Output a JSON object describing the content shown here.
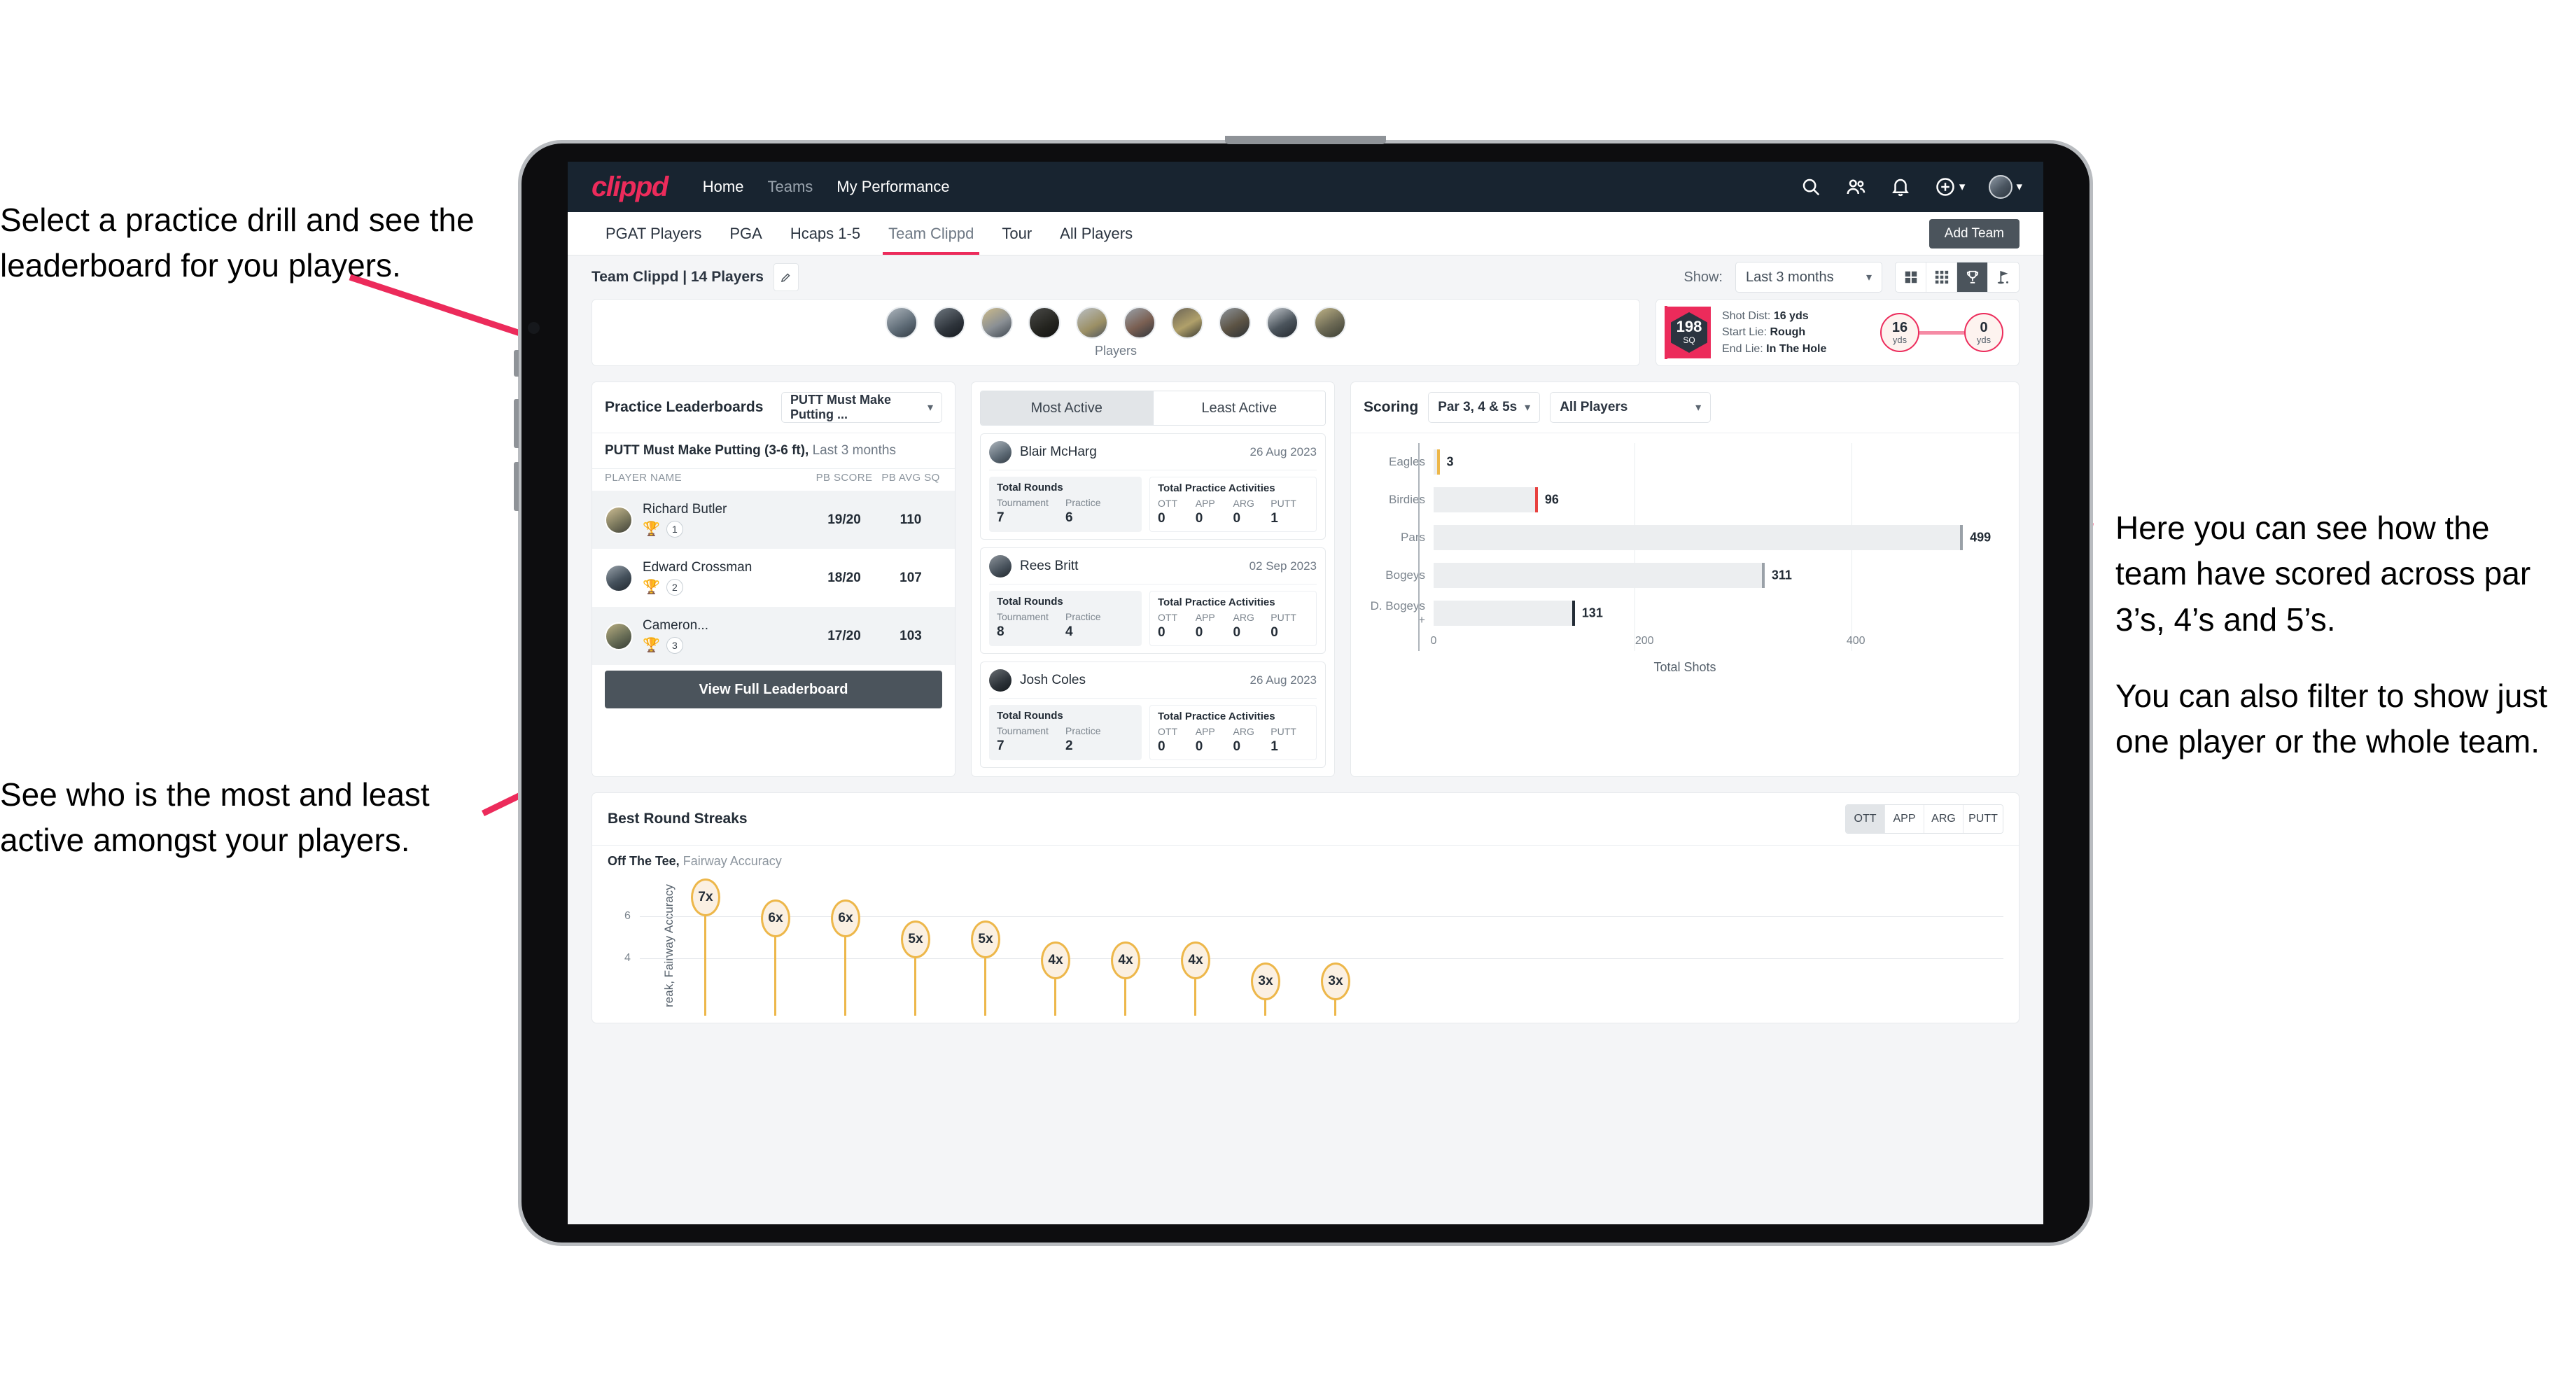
{
  "annotations": {
    "top_left": [
      "Select a practice drill and see the leaderboard for you players."
    ],
    "bottom_left": [
      "See who is the most and least active amongst your players."
    ],
    "right": [
      "Here you can see how the team have scored across par 3’s, 4’s and 5’s.",
      "You can also filter to show just one player or the whole team."
    ]
  },
  "accent": {
    "brand_pink": "#ec2b5b",
    "navy": "#182430",
    "slate": "#4b545c",
    "gold": "#edb74a"
  },
  "appbar": {
    "logo": "clippd",
    "nav": [
      {
        "label": "Home",
        "active": true
      },
      {
        "label": "Teams",
        "active": false
      },
      {
        "label": "My Performance",
        "active": true
      }
    ],
    "icons": [
      "search-icon",
      "people-icon",
      "bell-icon",
      "plus-circle-icon",
      "avatar"
    ]
  },
  "tabs": [
    {
      "label": "PGAT Players",
      "active": false
    },
    {
      "label": "PGA",
      "active": false
    },
    {
      "label": "Hcaps 1-5",
      "active": false
    },
    {
      "label": "Team Clippd",
      "active": true
    },
    {
      "label": "Tour",
      "active": false
    },
    {
      "label": "All Players",
      "active": false
    }
  ],
  "add_team_label": "Add Team",
  "subbar": {
    "team_label": "Team Clippd | 14 Players",
    "show_label": "Show:",
    "period_value": "Last 3 months",
    "view_toggles": [
      {
        "name": "grid-2x2-icon",
        "selected": false
      },
      {
        "name": "grid-3x3-icon",
        "selected": false
      },
      {
        "name": "trophy-icon",
        "selected": true
      },
      {
        "name": "golf-flag-icon",
        "selected": false
      }
    ]
  },
  "players_card": {
    "label": "Players",
    "avatar_count": 10
  },
  "shot_card": {
    "sq_value": "198",
    "sq_unit": "SQ",
    "lines": [
      {
        "key": "Shot Dist:",
        "value": "16 yds"
      },
      {
        "key": "Start Lie:",
        "value": "Rough"
      },
      {
        "key": "End Lie:",
        "value": "In The Hole"
      }
    ],
    "start_yds": "16",
    "end_yds": "0",
    "unit": "yds"
  },
  "leaderboard": {
    "title": "Practice Leaderboards",
    "drill_select": "PUTT Must Make Putting ...",
    "subtitle_bold": "PUTT Must Make Putting (3-6 ft),",
    "subtitle_rest": "Last 3 months",
    "columns": [
      "PLAYER NAME",
      "PB SCORE",
      "PB AVG SQ"
    ],
    "rows": [
      {
        "name": "Richard Butler",
        "rank": "1",
        "trophy": "gold",
        "score": "19/20",
        "avg": "110"
      },
      {
        "name": "Edward Crossman",
        "rank": "2",
        "trophy": "silver",
        "score": "18/20",
        "avg": "107"
      },
      {
        "name": "Cameron...",
        "rank": "3",
        "trophy": "bronze",
        "score": "17/20",
        "avg": "103"
      }
    ],
    "button": "View Full Leaderboard"
  },
  "activity": {
    "tabs": [
      {
        "label": "Most Active",
        "selected": true
      },
      {
        "label": "Least Active",
        "selected": false
      }
    ],
    "rounds_title": "Total Rounds",
    "rounds_cols": [
      "Tournament",
      "Practice"
    ],
    "acts_title": "Total Practice Activities",
    "acts_cols": [
      "OTT",
      "APP",
      "ARG",
      "PUTT"
    ],
    "items": [
      {
        "name": "Blair McHarg",
        "date": "26 Aug 2023",
        "rounds": [
          "7",
          "6"
        ],
        "acts": [
          "0",
          "0",
          "0",
          "1"
        ]
      },
      {
        "name": "Rees Britt",
        "date": "02 Sep 2023",
        "rounds": [
          "8",
          "4"
        ],
        "acts": [
          "0",
          "0",
          "0",
          "0"
        ]
      },
      {
        "name": "Josh Coles",
        "date": "26 Aug 2023",
        "rounds": [
          "7",
          "2"
        ],
        "acts": [
          "0",
          "0",
          "0",
          "1"
        ]
      }
    ]
  },
  "scoring": {
    "title": "Scoring",
    "par_select": "Par 3, 4 & 5s",
    "player_select": "All Players"
  },
  "streaks": {
    "title": "Best Round Streaks",
    "segments": [
      {
        "label": "OTT",
        "selected": true
      },
      {
        "label": "APP",
        "selected": false
      },
      {
        "label": "ARG",
        "selected": false
      },
      {
        "label": "PUTT",
        "selected": false
      }
    ],
    "subtitle_bold": "Off The Tee,",
    "subtitle_rest": "Fairway Accuracy",
    "y_axis_label": "reak, Fairway Accuracy",
    "y_ticks": [
      "6",
      "4"
    ]
  },
  "chart_data": [
    {
      "type": "bar",
      "orientation": "horizontal",
      "title": "Scoring",
      "categories": [
        "Eagles",
        "Birdies",
        "Pars",
        "Bogeys",
        "D. Bogeys +"
      ],
      "values": [
        3,
        96,
        499,
        311,
        131
      ],
      "cap_colors": [
        "#edb74a",
        "#e8413f",
        "#9aa1a8",
        "#9aa1a8",
        "#232c36"
      ],
      "xlabel": "Total Shots",
      "ylabel": "",
      "xlim": [
        0,
        540
      ],
      "xticks": [
        0,
        200,
        400
      ],
      "grid": true,
      "legend": "none"
    },
    {
      "type": "scatter",
      "title": "Best Round Streaks",
      "subtitle": "Off The Tee, Fairway Accuracy",
      "ylabel": "reak, Fairway Accuracy",
      "xlabel": "",
      "yticks": [
        6,
        4
      ],
      "ylim": [
        2.4,
        8
      ],
      "labels": [
        "7x",
        "6x",
        "6x",
        "5x",
        "5x",
        "4x",
        "4x",
        "4x",
        "3x",
        "3x"
      ],
      "values": [
        7,
        6,
        6,
        5,
        5,
        4,
        4,
        4,
        3,
        3
      ],
      "marker": "lollipop-ellipse",
      "marker_color": "#edb74a"
    }
  ]
}
